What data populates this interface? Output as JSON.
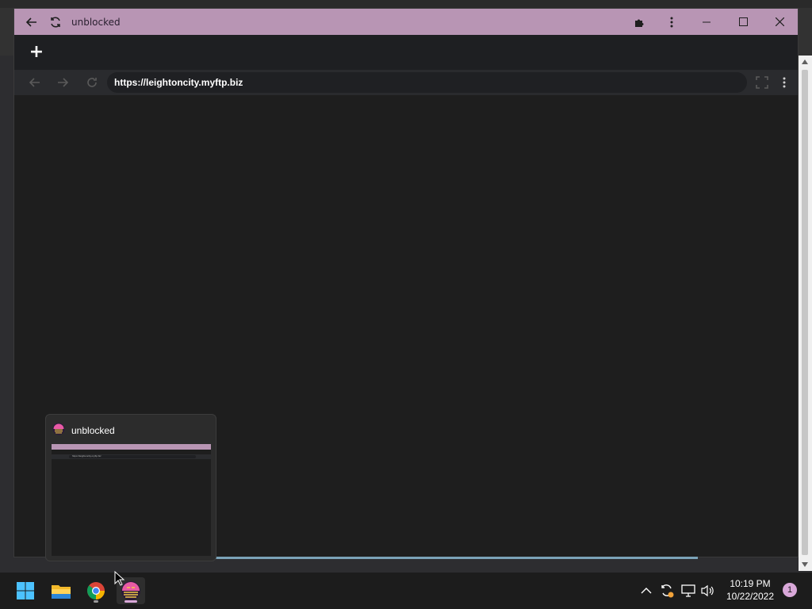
{
  "browser": {
    "window_title": "unblocked",
    "new_tab_label": "+",
    "address_url": "https://leightoncity.myftp.biz",
    "accent_color": "#b895b4"
  },
  "taskbar_preview": {
    "title": "unblocked",
    "thumbnail_url": "https://leightoncity.myftp.biz"
  },
  "taskbar": {
    "pinned_apps": [
      "windows-start-icon",
      "file-explorer-icon",
      "chrome-icon",
      "unblocked-app-icon"
    ],
    "clock": {
      "time": "10:19 PM",
      "date": "10/22/2022"
    },
    "notification_count": "1"
  }
}
